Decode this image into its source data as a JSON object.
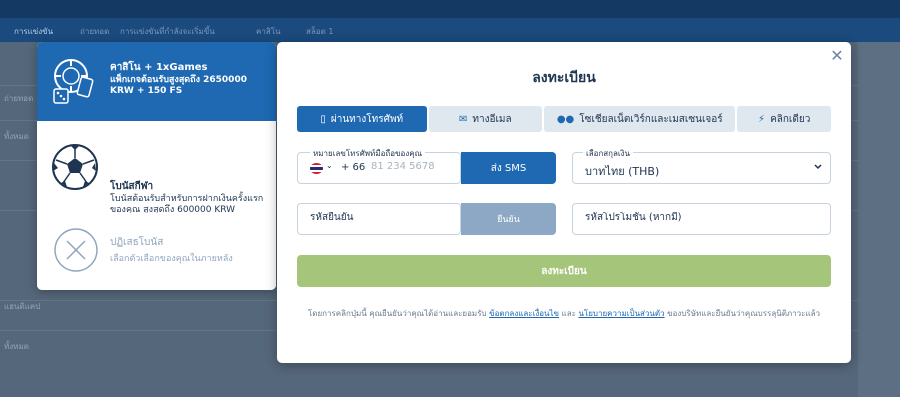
{
  "background": {
    "nav_items": [
      "การแข่งขัน",
      "ถ่ายทอด",
      "การแข่งขันที่กำลังจะเริ่มขึ้น",
      "คาสิโน",
      "สล็อต 1"
    ],
    "left_snippets": [
      "ถ่ายทอด",
      "ทั้งหมด",
      "แฮนดิแคป",
      "ทั้งหมด"
    ]
  },
  "bonuses": {
    "casino": {
      "title": "คาสิโน + 1xGames",
      "description": "แพ็กเกจต้อนรับสูงสุดถึง 2650000 KRW + 150 FS"
    },
    "sport": {
      "title": "โบนัสกีฬา",
      "description": "โบนัสต้อนรับสำหรับการฝากเงินครั้งแรกของคุณ สูงสุดถึง 600000 KRW"
    },
    "decline": {
      "title": "ปฏิเสธโบนัส",
      "description": "เลือกตัวเลือกของคุณในภายหลัง"
    }
  },
  "modal": {
    "title": "ลงทะเบียน",
    "tabs": [
      {
        "label": "ผ่านทางโทรศัพท์",
        "icon": "phone-icon",
        "active": true
      },
      {
        "label": "ทางอีเมล",
        "icon": "envelope-icon",
        "active": false
      },
      {
        "label": "โซเชียลเน็ตเวิร์กและเมสเซนเจอร์",
        "icon": "users-icon",
        "active": false
      },
      {
        "label": "คลิกเดียว",
        "icon": "lightning-icon",
        "active": false
      }
    ],
    "phone": {
      "label": "หมายเลขโทรศัพท์มือถือของคุณ",
      "country_code": "+ 66",
      "placeholder": "81 234 5678",
      "send_sms": "ส่ง SMS"
    },
    "currency": {
      "label": "เลือกสกุลเงิน",
      "value": "บาทไทย (THB)"
    },
    "confirmation": {
      "placeholder": "รหัสยืนยัน",
      "confirm": "ยืนยัน"
    },
    "promo": {
      "placeholder": "รหัสโปรโมชั่น (หากมี)"
    },
    "register_button": "ลงทะเบียน",
    "terms": {
      "prefix": "โดยการคลิกปุ่มนี้ คุณยืนยันว่าคุณได้อ่านและยอมรับ ",
      "link1": "ข้อตกลงและเงื่อนไข",
      "middle": " และ ",
      "link2": "นโยบายความเป็นส่วนตัว",
      "suffix": " ของบริษัทและยืนยันว่าคุณบรรลุนิติภาวะแล้ว"
    }
  },
  "colors": {
    "accent": "#1e69b2",
    "register": "#a5c57a",
    "confirm": "#8da8c4"
  }
}
